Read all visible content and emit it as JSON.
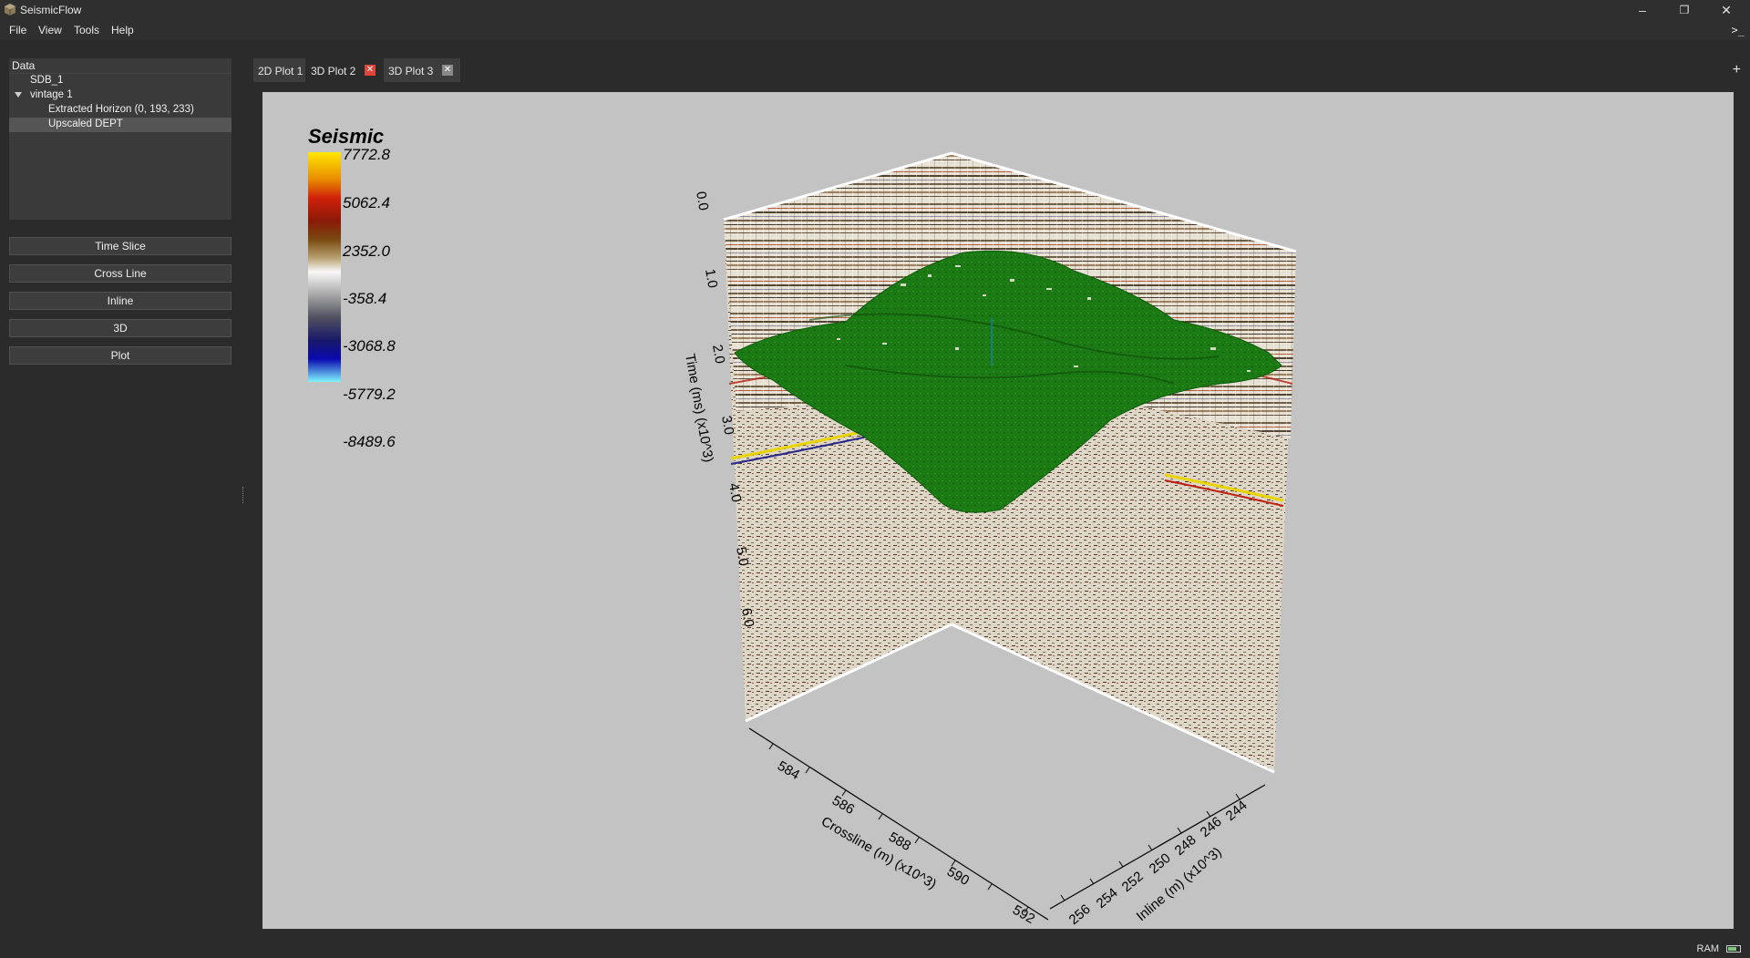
{
  "app": {
    "title": "SeismicFlow",
    "icon": "cube-icon"
  },
  "window_controls": {
    "minimize": "–",
    "restore": "❐",
    "close": "✕"
  },
  "menu": [
    "File",
    "View",
    "Tools",
    "Help"
  ],
  "console_icon": ">_",
  "data_panel": {
    "header": "Data",
    "tree": [
      {
        "label": "SDB_1",
        "level": 1,
        "expanded": false,
        "selected": false
      },
      {
        "label": "vintage 1",
        "level": 1,
        "expanded": true,
        "selected": false
      },
      {
        "label": "Extracted Horizon (0, 193, 233)",
        "level": 2,
        "expanded": false,
        "selected": false
      },
      {
        "label": "Upscaled DEPT",
        "level": 2,
        "expanded": false,
        "selected": true
      }
    ]
  },
  "buttons": [
    "Time Slice",
    "Cross Line",
    "Inline",
    "3D",
    "Plot"
  ],
  "tabs": [
    {
      "label": "2D Plot 1",
      "active": false,
      "closable": false
    },
    {
      "label": "3D Plot 2",
      "active": true,
      "closable": true,
      "close_color": "#e0453a"
    },
    {
      "label": "3D Plot 3",
      "active": false,
      "closable": true,
      "close_color": "#8a8a8a"
    }
  ],
  "add_tab": "+",
  "plot": {
    "colorbar": {
      "title": "Seismic",
      "ticks": [
        "7772.8",
        "5062.4",
        "2352.0",
        "-358.4",
        "-3068.8",
        "-5779.2",
        "-8489.6"
      ],
      "colors": [
        "#ffe600",
        "#e88a00",
        "#c01a0a",
        "#7a3a05",
        "#c8b898",
        "#f6f6f6",
        "#a0a0a0",
        "#505060",
        "#1a1a6a",
        "#0a0aa8",
        "#80f0ff"
      ]
    },
    "axes": {
      "time_label": "Time (ms) (x10^3)",
      "time_ticks": [
        "0.0",
        "1.0",
        "2.0",
        "3.0",
        "4.0",
        "5.0",
        "6.0"
      ],
      "crossline_label": "Crossline (m) (x10^3)",
      "crossline_ticks": [
        "584",
        "586",
        "588",
        "590",
        "592"
      ],
      "inline_label": "Inline (m) (x10^3)",
      "inline_ticks": [
        "256",
        "254",
        "252",
        "250",
        "248",
        "246",
        "244"
      ]
    },
    "horizon_color": "#1a7a12",
    "background": "#c3c3c3"
  },
  "status": {
    "ram_label": "RAM",
    "ram_usage": 0.75
  }
}
